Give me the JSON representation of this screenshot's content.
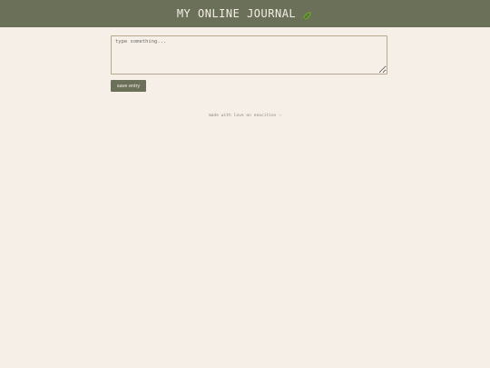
{
  "header": {
    "title": "MY ONLINE JOURNAL",
    "icon": "leaf-icon"
  },
  "editor": {
    "placeholder": "type something...",
    "value": ""
  },
  "actions": {
    "save_label": "save entry"
  },
  "footer": {
    "text": "made with love on neocities ✧"
  },
  "colors": {
    "background": "#f6efe7",
    "header": "#6b7059",
    "accent_leaf": "#6f9a3a",
    "border": "#b5a88e"
  }
}
